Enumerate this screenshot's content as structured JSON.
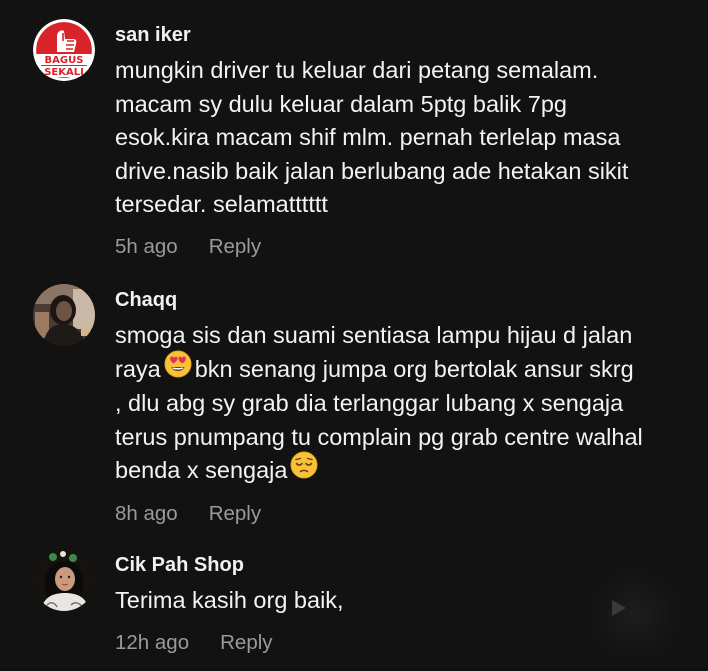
{
  "comments": [
    {
      "username": "san iker",
      "avatar": {
        "icon": "bagus-sekali-thumbs-up-icon",
        "logo_text": "BAGUS SEKALI",
        "bg_color": "#ffffff",
        "accent_color": "#d9232b"
      },
      "lines": [
        "mungkin driver tu keluar dari petang semalam.",
        "macam sy dulu keluar dalam 5ptg balik 7pg",
        "esok.kira macam shif mlm. pernah terlelap masa",
        "drive.nasib baik jalan berlubang ade hetakan sikit",
        "tersedar. selamatttttt"
      ],
      "time": "5h ago",
      "reply_label": "Reply"
    },
    {
      "username": "Chaqq",
      "avatar": {
        "icon": "user-photo-avatar"
      },
      "lines": [
        {
          "before": "smoga sis dan suami sentiasa lampu hijau d jalan",
          "emoji": null,
          "after": ""
        },
        {
          "before": "raya",
          "emoji": "heart-eyes-emoji-icon",
          "after": "bkn senang jumpa org bertolak ansur skrg"
        },
        {
          "before": ", dlu abg sy grab dia terlanggar lubang x sengaja",
          "emoji": null,
          "after": ""
        },
        {
          "before": "terus pnumpang tu complain pg grab centre walhal",
          "emoji": null,
          "after": ""
        },
        {
          "before": "benda x sengaja",
          "emoji": "pensive-face-emoji-icon",
          "after": ""
        }
      ],
      "time": "8h ago",
      "reply_label": "Reply"
    },
    {
      "username": "Cik Pah Shop",
      "avatar": {
        "icon": "user-photo-avatar"
      },
      "lines": [
        "Terima kasih org baik,"
      ],
      "time": "12h ago",
      "reply_label": "Reply"
    }
  ],
  "overlay": {
    "icon": "play-icon"
  },
  "colors": {
    "background": "#121212",
    "username": "#f1f1f1",
    "text": "#f3f3f3",
    "meta": "#9a9a9a"
  }
}
